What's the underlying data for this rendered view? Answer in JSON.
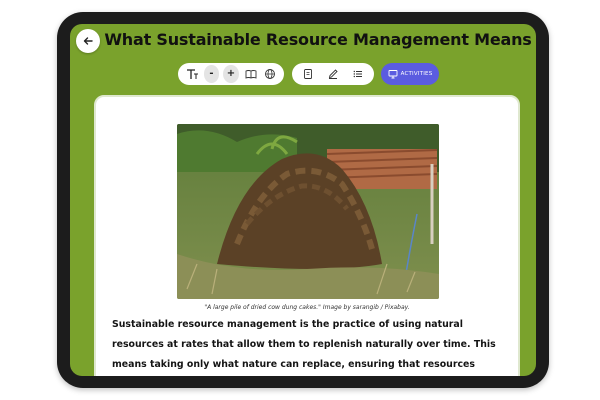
{
  "page": {
    "title": "What Sustainable Resource Management Means"
  },
  "toolbar": {
    "text_tools": [
      "text-size-icon",
      "decrease-text-icon",
      "increase-text-icon",
      "book-icon",
      "globe-icon"
    ],
    "decrease_label": "-",
    "increase_label": "+",
    "reading_tools": [
      "notebook-icon",
      "pen-icon",
      "list-icon"
    ],
    "activities_label": "ACTIVITIES"
  },
  "image": {
    "caption": "\"A large pile of dried cow dung cakes.\" Image by sarangib / Pixabay."
  },
  "article": {
    "paragraph": "Sustainable resource management is the practice of using natural resources at rates that allow them to replenish naturally over time. This means taking only what nature can replace, ensuring that resources remain available for future"
  },
  "colors": {
    "screen_bg": "#7aa22c",
    "accent": "#5b5ce0",
    "bezel": "#1c1c1c"
  }
}
